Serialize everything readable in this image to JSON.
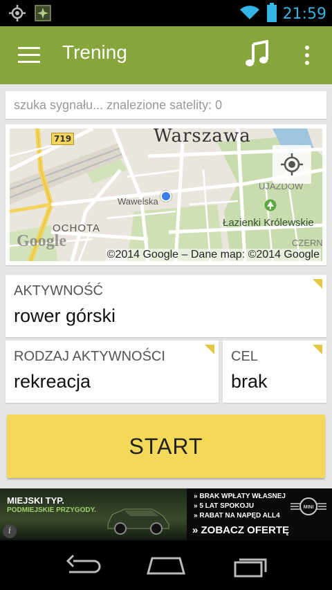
{
  "status_bar": {
    "time": "21:59",
    "icons": [
      "gps-icon",
      "satellite-app-icon",
      "wifi-icon",
      "battery-icon"
    ]
  },
  "action_bar": {
    "title": "Trening",
    "icons": [
      "menu-icon",
      "music-note-icon",
      "overflow-menu-icon"
    ],
    "color": "#86a53a"
  },
  "gps_status": "szuka sygnału... znalezione satelity: 0",
  "map": {
    "city": "Warszawa",
    "route_badge": "719",
    "labels": {
      "wawelska": "Wawelska",
      "ochota": "OCHOTA",
      "ujazdow": "UJAZDÓW",
      "lazienki": "Łazienki Królewskie",
      "czern": "CZERN"
    },
    "logo": "Google",
    "copyright": "©2014 Google – Dane map: ©2014 Google",
    "icons": [
      "my-location-icon",
      "current-position-dot-icon",
      "park-tree-icon"
    ]
  },
  "fields": {
    "activity": {
      "label": "AKTYWNOŚĆ",
      "value": "rower górski"
    },
    "activity_type": {
      "label": "RODZAJ AKTYWNOŚCI",
      "value": "rekreacja"
    },
    "goal": {
      "label": "CEL",
      "value": "brak"
    }
  },
  "start_button": {
    "label": "START",
    "color": "#f4d85a"
  },
  "ad": {
    "left_title": "MIEJSKI TYP.",
    "left_subtitle": "PODMIEJSKIE PRZYGODY.",
    "line1": "BRAK WPŁATY WŁASNEJ",
    "line2": "5 LAT SPOKOJU",
    "line3": "RABAT NA NAPĘD ALL4",
    "cta": "» ZOBACZ OFERTĘ",
    "info_icon": "i",
    "brand_logo": "MINI"
  },
  "nav_bar": {
    "icons": [
      "back-icon",
      "home-icon",
      "recent-apps-icon"
    ]
  }
}
